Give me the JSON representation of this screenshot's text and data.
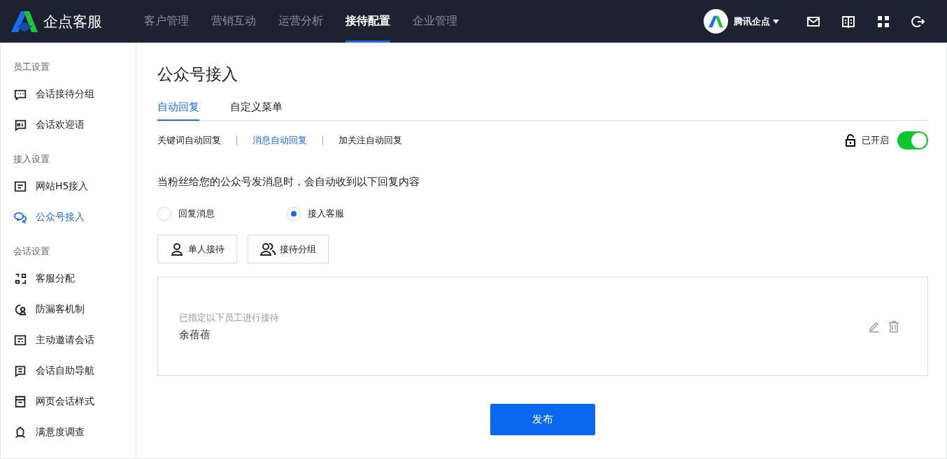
{
  "brand": {
    "name": "企点客服"
  },
  "nav": [
    {
      "label": "客户管理",
      "selected": false
    },
    {
      "label": "营销互动",
      "selected": false
    },
    {
      "label": "运营分析",
      "selected": false
    },
    {
      "label": "接待配置",
      "selected": true
    },
    {
      "label": "企业管理",
      "selected": false
    }
  ],
  "account": {
    "name": "腾讯企点"
  },
  "sidebar": [
    {
      "title": "员工设置",
      "items": [
        {
          "label": "会话接待分组",
          "selected": false
        },
        {
          "label": "会话欢迎语",
          "selected": false
        }
      ]
    },
    {
      "title": "接入设置",
      "items": [
        {
          "label": "网站H5接入",
          "selected": false
        },
        {
          "label": "公众号接入",
          "selected": true
        }
      ]
    },
    {
      "title": "会话设置",
      "items": [
        {
          "label": "客服分配",
          "selected": false
        },
        {
          "label": "防漏客机制",
          "selected": false
        },
        {
          "label": "主动邀请会话",
          "selected": false
        },
        {
          "label": "会话自助导航",
          "selected": false
        },
        {
          "label": "网页会话样式",
          "selected": false
        },
        {
          "label": "满意度调查",
          "selected": false
        }
      ]
    }
  ],
  "page_title": "公众号接入",
  "tabs": [
    {
      "label": "自动回复",
      "selected": true
    },
    {
      "label": "自定义菜单",
      "selected": false
    }
  ],
  "subtabs": [
    {
      "label": "关键词自动回复",
      "selected": false
    },
    {
      "label": "消息自动回复",
      "selected": true
    },
    {
      "label": "加关注自动回复",
      "selected": false
    }
  ],
  "switch": {
    "label": "已开启",
    "on": true
  },
  "description": "当粉丝给您的公众号发消息时，会自动收到以下回复内容",
  "radios": [
    {
      "label": "回复消息",
      "selected": false
    },
    {
      "label": "接入客服",
      "selected": true
    }
  ],
  "mode_buttons": [
    {
      "label": "单人接待"
    },
    {
      "label": "接待分组"
    }
  ],
  "assignment": {
    "caption": "已指定以下员工进行接待",
    "name": "余蓓蓓"
  },
  "publish_button": "发布"
}
